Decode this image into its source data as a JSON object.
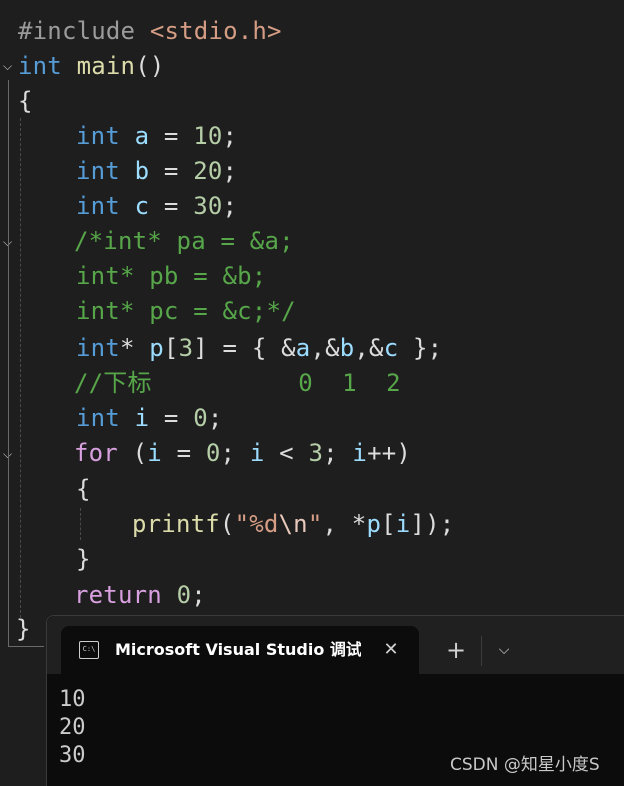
{
  "editor": {
    "line1": {
      "directive": "#include",
      "header": "<stdio.h>"
    },
    "line2": {
      "type": "int",
      "name": "main",
      "parens": "()"
    },
    "line3": {
      "brace": "{"
    },
    "line4": {
      "type": "int",
      "var": "a",
      "eq": " = ",
      "val": "10",
      "semi": ";"
    },
    "line5": {
      "type": "int",
      "var": "b",
      "eq": " = ",
      "val": "20",
      "semi": ";"
    },
    "line6": {
      "type": "int",
      "var": "c",
      "eq": " = ",
      "val": "30",
      "semi": ";"
    },
    "line7": {
      "comment": "/*int* pa = &a;"
    },
    "line8": {
      "comment": "int* pb = &b;"
    },
    "line9": {
      "comment": "int* pc = &c;*/"
    },
    "line10": {
      "type": "int",
      "star": "* ",
      "var": "p",
      "open": "[",
      "size": "3",
      "close": "] = { &",
      "a": "a",
      "sep1": ",&",
      "b": "b",
      "sep2": ",&",
      "c": "c",
      "end": " };"
    },
    "line11": {
      "comment": "//下标          0  1  2"
    },
    "line12": {
      "type": "int",
      "var": "i",
      "eq": " = ",
      "val": "0",
      "semi": ";"
    },
    "line13": {
      "kw": "for",
      "p1": " (",
      "v1": "i",
      "eq": " = ",
      "n1": "0",
      "s1": "; ",
      "v2": "i",
      "lt": " < ",
      "n2": "3",
      "s2": "; ",
      "v3": "i",
      "inc": "++)"
    },
    "line14": {
      "brace": "{"
    },
    "line15": {
      "fn": "printf",
      "p1": "(",
      "q1": "\"",
      "fmt": "%d",
      "esc": "\\n",
      "q2": "\"",
      "rest1": ", *",
      "var": "p",
      "br1": "[",
      "idx": "i",
      "br2": "]);"
    },
    "line16": {
      "brace": "}"
    },
    "line17": {
      "kw": "return",
      "sp": " ",
      "val": "0",
      "semi": ";"
    },
    "line18": {
      "brace": "}"
    }
  },
  "terminal": {
    "tab_icon": "C:\\",
    "tab_title": "Microsoft Visual Studio 调试控制台",
    "close_glyph": "✕",
    "new_tab_glyph": "+",
    "dropdown_glyph": "⌵",
    "output": [
      "10",
      "20",
      "30"
    ]
  },
  "watermark": "CSDN @知星小度S",
  "colors": {
    "editor_bg": "#1e1e1e",
    "keyword": "#569cd6",
    "variable": "#9cdcfe",
    "number": "#b5cea8",
    "comment": "#57a64a",
    "string": "#d69d85",
    "function": "#dcdcaa",
    "control": "#d8a0df",
    "terminal_bg": "#0c0c0c",
    "tabbar_bg": "#202020"
  }
}
